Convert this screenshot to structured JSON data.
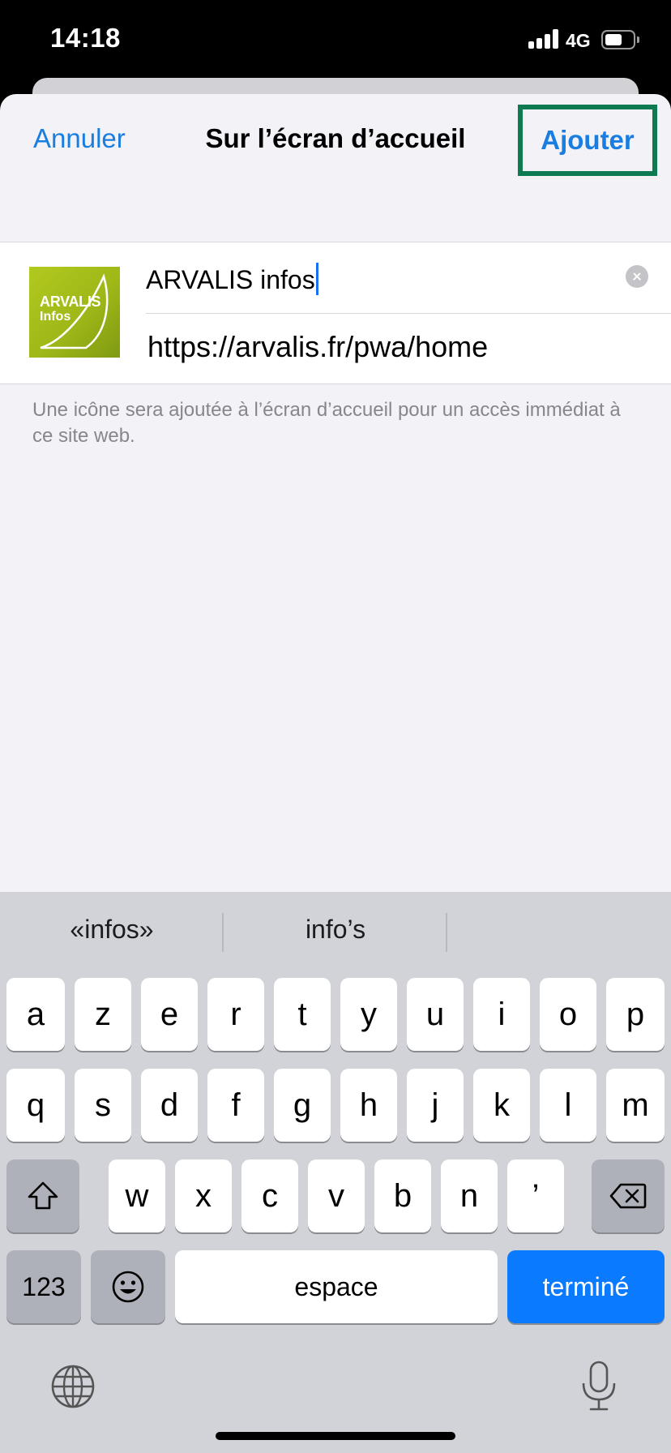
{
  "status_bar": {
    "time": "14:18",
    "network": "4G"
  },
  "nav": {
    "cancel_label": "Annuler",
    "title": "Sur l’écran d’accueil",
    "add_label": "Ajouter"
  },
  "app_icon": {
    "line1": "ARVALIS",
    "line2": "Infos"
  },
  "form": {
    "name_value": "ARVALIS infos",
    "url_value": "https://arvalis.fr/pwa/home"
  },
  "footnote": "Une icône sera ajoutée à l’écran d’accueil pour un accès immédiat à ce site web.",
  "keyboard": {
    "suggestions": [
      "«infos»",
      "info’s"
    ],
    "row1": [
      "a",
      "z",
      "e",
      "r",
      "t",
      "y",
      "u",
      "i",
      "o",
      "p"
    ],
    "row2": [
      "q",
      "s",
      "d",
      "f",
      "g",
      "h",
      "j",
      "k",
      "l",
      "m"
    ],
    "row3": [
      "w",
      "x",
      "c",
      "v",
      "b",
      "n",
      "’"
    ],
    "numbers_label": "123",
    "space_label": "espace",
    "done_label": "terminé"
  },
  "colors": {
    "accent": "#1a7de0",
    "highlight_border": "#0e7a52",
    "done_key": "#0a7aff"
  }
}
